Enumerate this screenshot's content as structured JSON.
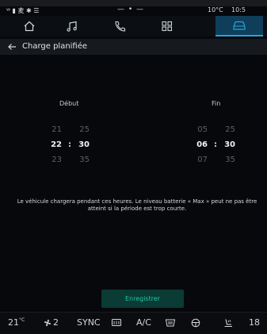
{
  "status_bar": {
    "indicators": "ᵂ ▮ ⻨ ✱ ☰",
    "center": "— • —",
    "temperature": "10°C",
    "time": "10:5"
  },
  "nav": {
    "items": [
      {
        "icon": "home-icon"
      },
      {
        "icon": "music-icon"
      },
      {
        "icon": "phone-icon"
      },
      {
        "icon": "apps-icon"
      },
      {
        "icon": "car-icon"
      }
    ],
    "active_index": 4
  },
  "header": {
    "title": "Charge planifiée"
  },
  "start": {
    "label": "Début",
    "prev_hour": "21",
    "prev_min": "25",
    "hour": "22",
    "sep": ":",
    "min": "30",
    "next_hour": "23",
    "next_min": "35"
  },
  "end": {
    "label": "Fin",
    "prev_hour": "05",
    "prev_min": "25",
    "hour": "06",
    "sep": ":",
    "min": "30",
    "next_hour": "07",
    "next_min": "35"
  },
  "info_text_line1": "Le véhicule chargera pendant ces heures. Le niveau batterie « Max » peut ne pas être",
  "info_text_line2": "atteint si la période est trop courte.",
  "save_label": "Enregistrer",
  "climate": {
    "left_temp": "21",
    "left_unit": "°C",
    "fan_level": "2",
    "sync": "SYNC",
    "ac": "A/C",
    "right_temp": "18"
  },
  "colors": {
    "accent": "#2aa3d8",
    "save_text": "#23c6a3",
    "save_bg": "#0a3b34"
  }
}
